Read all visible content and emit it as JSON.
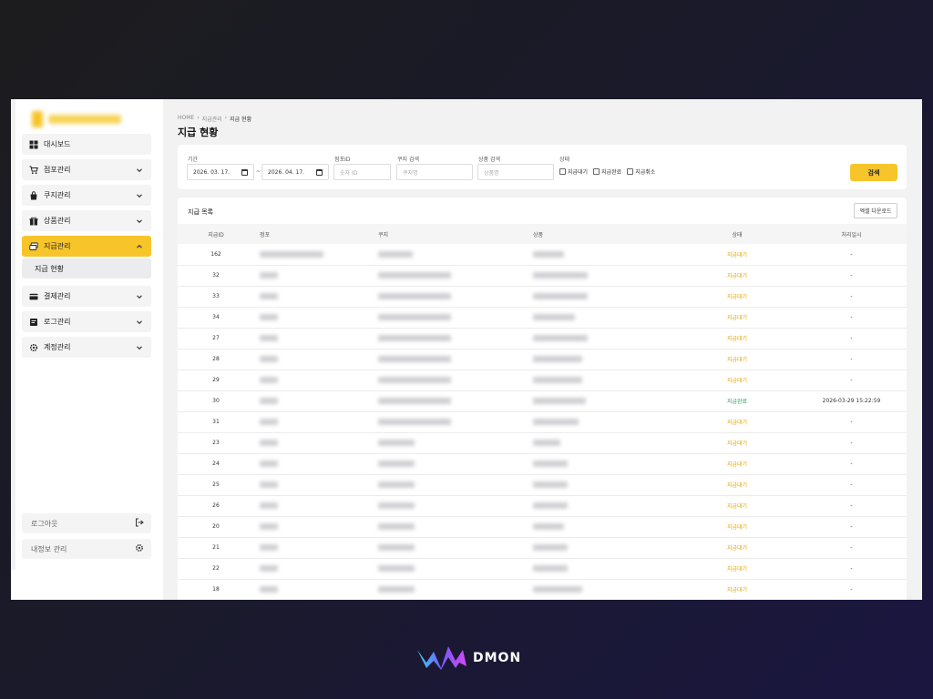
{
  "sidebar": {
    "items": [
      {
        "label": "대시보드",
        "icon": "grid-icon",
        "expandable": false,
        "active": false
      },
      {
        "label": "점포관리",
        "icon": "cart-icon",
        "expandable": true,
        "active": false
      },
      {
        "label": "쿠지관리",
        "icon": "bag-icon",
        "expandable": true,
        "active": false
      },
      {
        "label": "상품관리",
        "icon": "gift-icon",
        "expandable": true,
        "active": false
      },
      {
        "label": "지급관리",
        "icon": "cards-icon",
        "expandable": true,
        "active": true
      },
      {
        "label": "결제관리",
        "icon": "card-icon",
        "expandable": true,
        "active": false
      },
      {
        "label": "로그관리",
        "icon": "doc-icon",
        "expandable": true,
        "active": false
      },
      {
        "label": "계정관리",
        "icon": "gear-icon",
        "expandable": true,
        "active": false
      }
    ],
    "sub_item": "지급 현황",
    "logout": "로그아웃",
    "my_info": "내정보 관리"
  },
  "breadcrumb": [
    "HOME",
    "지급관리",
    "지급 현황"
  ],
  "page_title": "지급 현황",
  "filters": {
    "period_label": "기간",
    "date_from": "2026. 03. 17.",
    "date_to": "2026. 04. 17.",
    "tilde": "~",
    "store_id_label": "점포ID",
    "store_id_placeholder": "숫자 ID",
    "kuji_label": "쿠지 검색",
    "kuji_placeholder": "쿠지명",
    "product_label": "상품 검색",
    "product_placeholder": "상품명",
    "status_label": "상태",
    "checkboxes": [
      "지급대기",
      "지급완료",
      "지급취소"
    ],
    "search_button": "검색"
  },
  "list": {
    "title": "지급 목록",
    "excel_button": "엑셀 다운로드",
    "columns": [
      "지급ID",
      "점포",
      "쿠지",
      "상품",
      "상태",
      "처리일시"
    ],
    "rows": [
      {
        "id": "162",
        "status": "지급대기",
        "date": "-"
      },
      {
        "id": "32",
        "status": "지급대기",
        "date": "-"
      },
      {
        "id": "33",
        "status": "지급대기",
        "date": "-"
      },
      {
        "id": "34",
        "status": "지급대기",
        "date": "-"
      },
      {
        "id": "27",
        "status": "지급대기",
        "date": "-"
      },
      {
        "id": "28",
        "status": "지급대기",
        "date": "-"
      },
      {
        "id": "29",
        "status": "지급대기",
        "date": "-"
      },
      {
        "id": "30",
        "status": "지급완료",
        "date": "2026-03-29 15:22:59"
      },
      {
        "id": "31",
        "status": "지급대기",
        "date": "-"
      },
      {
        "id": "23",
        "status": "지급대기",
        "date": "-"
      },
      {
        "id": "24",
        "status": "지급대기",
        "date": "-"
      },
      {
        "id": "25",
        "status": "지급대기",
        "date": "-"
      },
      {
        "id": "26",
        "status": "지급대기",
        "date": "-"
      },
      {
        "id": "20",
        "status": "지급대기",
        "date": "-"
      },
      {
        "id": "21",
        "status": "지급대기",
        "date": "-"
      },
      {
        "id": "22",
        "status": "지급대기",
        "date": "-"
      },
      {
        "id": "18",
        "status": "지급대기",
        "date": "-"
      }
    ]
  },
  "brand": {
    "name": "DMON",
    "icon": "dmon-logo-icon"
  },
  "colors": {
    "accent": "#f7c52a",
    "wait": "#e8a400",
    "done": "#2a9d5a"
  }
}
